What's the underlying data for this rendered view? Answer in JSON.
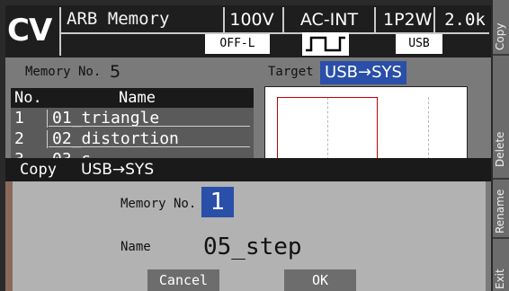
{
  "header": {
    "mode": "CV",
    "screen_title": "ARB Memory",
    "voltage_range": "100V",
    "source": "AC-INT",
    "wiring": "1P2W",
    "current_range": "2.0k",
    "output_status": "OFF-L",
    "waveform_icon": "square-wave-icon",
    "interface": "USB"
  },
  "main": {
    "memory_no_label": "Memory No.",
    "memory_no_value": "5",
    "target_label": "Target",
    "target_value": "USB→SYS",
    "list": {
      "columns": [
        "No.",
        "Name"
      ],
      "rows": [
        {
          "no": "1",
          "name": "01_triangle"
        },
        {
          "no": "2",
          "name": "02_distortion"
        },
        {
          "no": "3",
          "name": "03_s..."
        }
      ]
    }
  },
  "dialog": {
    "title_action": "Copy",
    "title_target": "USB→SYS",
    "memory_no_label": "Memory No.",
    "memory_no_value": "1",
    "name_label": "Name",
    "name_value": "05_step",
    "cancel_label": "Cancel",
    "ok_label": "OK"
  },
  "softkeys": [
    "Copy",
    "Delete",
    "Rename",
    "Exit"
  ],
  "colors": {
    "highlight": "#2a4fa8",
    "panel": "#7a7a7a",
    "dialog": "#b2b2b2",
    "waveform_red": "#c00000"
  }
}
